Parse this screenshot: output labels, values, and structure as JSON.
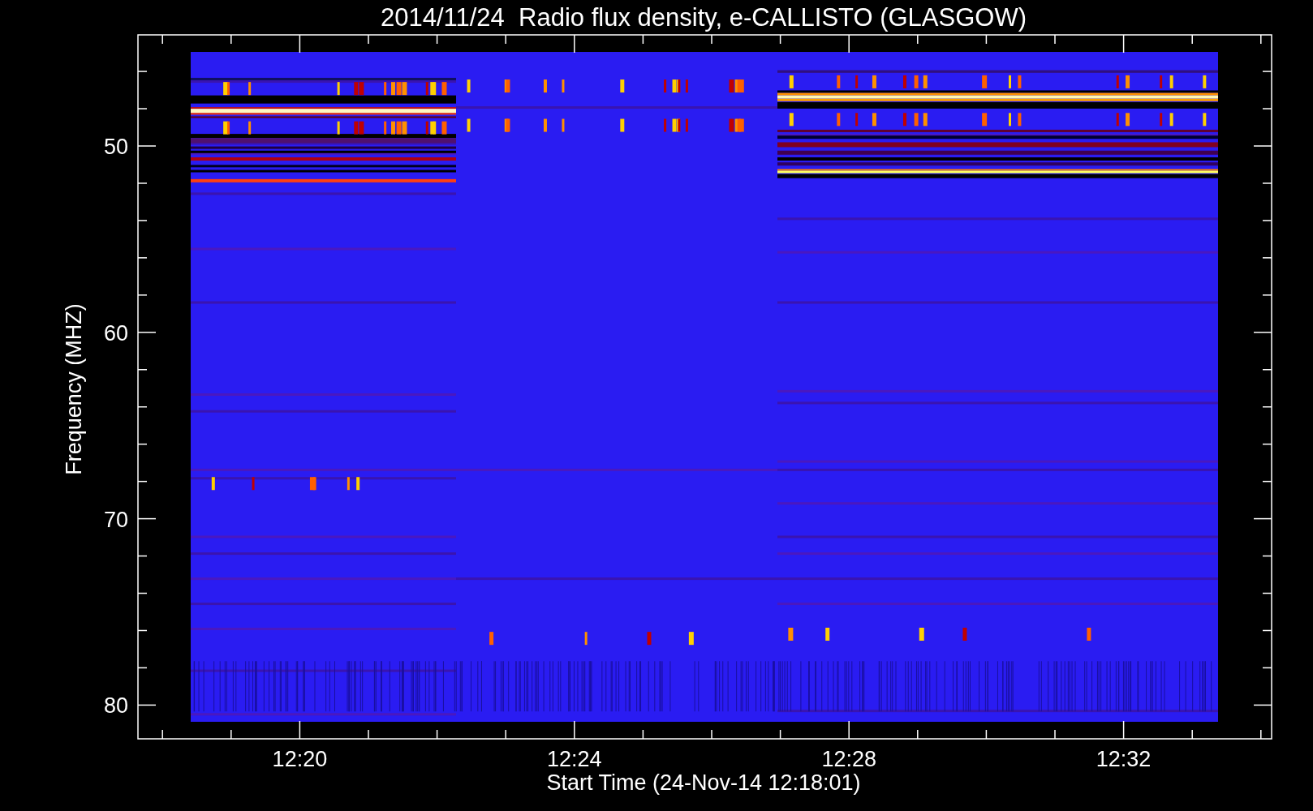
{
  "title": "2014/11/24  Radio flux density, e-CALLISTO (GLASGOW)",
  "y_axis": {
    "label": "Frequency (MHZ)",
    "ticks": [
      "50",
      "60",
      "70",
      "80"
    ]
  },
  "x_axis": {
    "label": "Start Time (24-Nov-14 12:18:01)",
    "ticks": [
      "12:20",
      "12:24",
      "12:28",
      "12:32"
    ]
  }
}
